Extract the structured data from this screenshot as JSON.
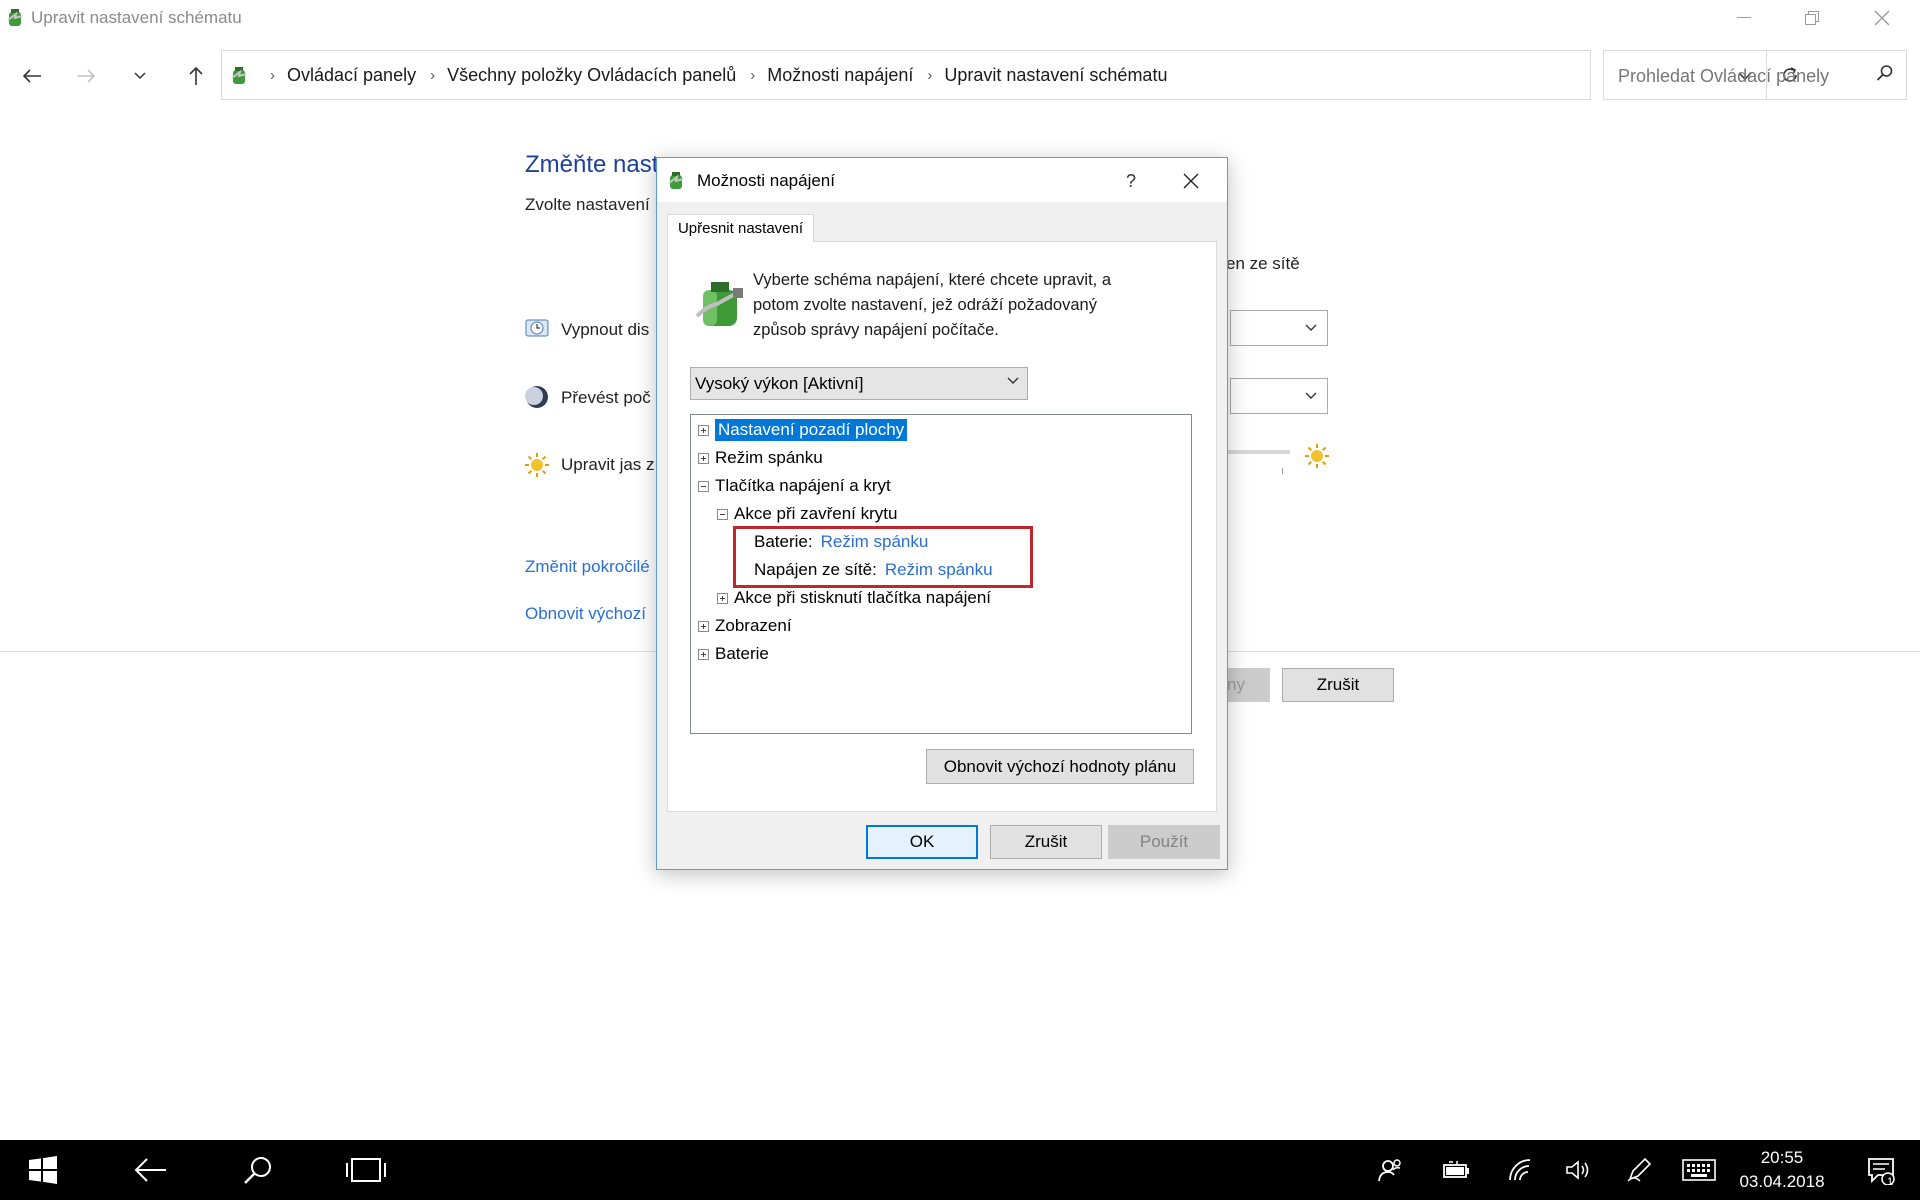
{
  "window": {
    "title": "Upravit nastavení schématu"
  },
  "address": {
    "crumbs": [
      "Ovládací panely",
      "Všechny položky Ovládacích panelů",
      "Možnosti napájení",
      "Upravit nastavení schématu"
    ],
    "search_placeholder": "Prohledat Ovládací panely"
  },
  "background_page": {
    "title": "Změňte nast",
    "subtitle": "Zvolte nastavení",
    "col_header_suffix": "en ze sítě",
    "row_display": "Vypnout dis",
    "row_sleep": "Převést poč",
    "row_brightness": "Upravit jas z",
    "link_advanced": "Změnit pokročilé",
    "link_restore": "Obnovit výchozí",
    "save_partial": "ny",
    "cancel": "Zrušit"
  },
  "dialog": {
    "title": "Možnosti napájení",
    "help": "?",
    "tab": "Upřesnit nastavení",
    "intro": "Vyberte schéma napájení, které chcete upravit, a potom zvolte nastavení, jež odráží požadovaný způsob správy napájení počítače.",
    "plan_selected": "Vysoký výkon [Aktivní]",
    "tree": {
      "desktop_bg": "Nastavení pozadí plochy",
      "sleep": "Režim spánku",
      "buttons_lid": "Tlačítka napájení a kryt",
      "lid_close": "Akce při zavření krytu",
      "battery_label": "Baterie:",
      "battery_value": "Režim spánku",
      "plugged_label": "Napájen ze sítě:",
      "plugged_value": "Režim spánku",
      "power_button": "Akce při stisknutí tlačítka napájení",
      "display": "Zobrazení",
      "battery": "Baterie"
    },
    "restore_button": "Obnovit výchozí hodnoty plánu",
    "ok": "OK",
    "cancel": "Zrušit",
    "apply": "Použít"
  },
  "taskbar": {
    "time": "20:55",
    "date": "03.04.2018",
    "notification_count": "1"
  },
  "colors": {
    "selection": "#0078d7",
    "link": "#2a6fcf",
    "highlight_box": "#c0272d",
    "heading": "#1e3f9a"
  },
  "icons": [
    "power-options-icon",
    "back-arrow-icon",
    "forward-arrow-icon",
    "recent-dropdown-icon",
    "up-arrow-icon",
    "refresh-icon",
    "search-icon",
    "close-icon",
    "help-icon",
    "windows-start-icon",
    "search-icon",
    "task-view-icon",
    "people-icon",
    "battery-icon",
    "wifi-icon",
    "volume-icon",
    "pen-icon",
    "keyboard-icon",
    "action-center-icon"
  ]
}
